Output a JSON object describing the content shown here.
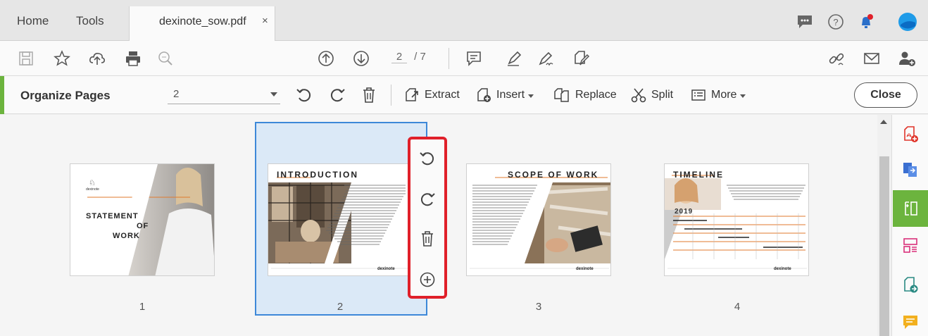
{
  "tabs": {
    "home": "Home",
    "tools": "Tools",
    "document": "dexinote_sow.pdf",
    "close_symbol": "×"
  },
  "toolbar": {
    "current_page": "2",
    "total_pages": "/ 7"
  },
  "organize": {
    "title": "Organize Pages",
    "selected_pages": "2",
    "extract": "Extract",
    "insert": "Insert",
    "replace": "Replace",
    "split": "Split",
    "more": "More",
    "close": "Close"
  },
  "pages": [
    {
      "number": "1",
      "heading": "STATEMENT OF WORK"
    },
    {
      "number": "2",
      "heading": "INTRODUCTION"
    },
    {
      "number": "3",
      "heading": "SCOPE OF WORK"
    },
    {
      "number": "4",
      "heading": "TIMELINE"
    }
  ],
  "page_texts": {
    "p1_line1": "STATEMENT",
    "p1_line2": "OF",
    "p1_line3": "WORK",
    "year": "2019",
    "brand": "dexinote"
  },
  "colors": {
    "accent_green": "#6cb43e",
    "selection_blue": "#3d88d8",
    "highlight_red": "#e0202a"
  }
}
